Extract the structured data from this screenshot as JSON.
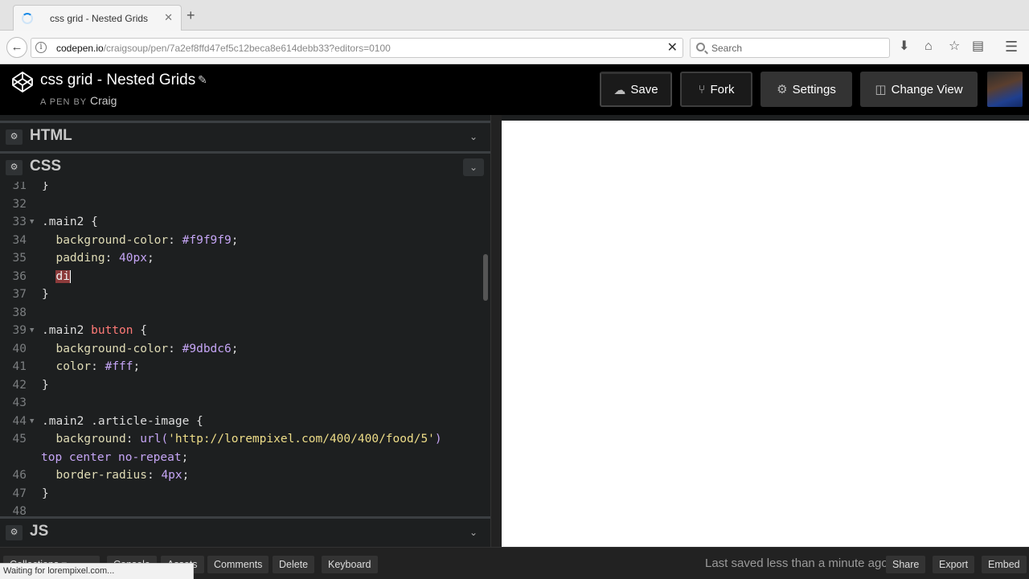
{
  "browser": {
    "tab": {
      "title": "css grid - Nested Grids",
      "close_glyph": "✕"
    },
    "new_tab_glyph": "+",
    "url": {
      "host": "codepen.io",
      "path": "/craigsoup/pen/7a2ef8ffd47ef5c12beca8e614debb33?editors=0100"
    },
    "search": {
      "placeholder": "Search"
    },
    "status_text": "Waiting for lorempixel.com..."
  },
  "header": {
    "pen_title": "css grid - Nested Grids",
    "pen_by_label": "A PEN BY",
    "author": "Craig",
    "buttons": {
      "save": "Save",
      "fork": "Fork",
      "settings": "Settings",
      "change_view": "Change View"
    }
  },
  "editors": {
    "html": {
      "name": "HTML"
    },
    "css": {
      "name": "CSS"
    },
    "js": {
      "name": "JS"
    }
  },
  "code": {
    "language": "css",
    "lines": [
      {
        "n": "31",
        "text": "}"
      },
      {
        "n": "32",
        "text": ""
      },
      {
        "n": "33",
        "text": ".main2 {"
      },
      {
        "n": "34",
        "text": "  background-color: #f9f9f9;"
      },
      {
        "n": "35",
        "text": "  padding: 40px;"
      },
      {
        "n": "36",
        "text": "  di"
      },
      {
        "n": "37",
        "text": "}"
      },
      {
        "n": "38",
        "text": ""
      },
      {
        "n": "39",
        "text": ".main2 button {"
      },
      {
        "n": "40",
        "text": "  background-color: #9dbdc6;"
      },
      {
        "n": "41",
        "text": "  color: #fff;"
      },
      {
        "n": "42",
        "text": "}"
      },
      {
        "n": "43",
        "text": ""
      },
      {
        "n": "44",
        "text": ".main2 .article-image {"
      },
      {
        "n": "45",
        "text": "  background: url('http://lorempixel.com/400/400/food/5')"
      },
      {
        "n": "",
        "text": "top center no-repeat;"
      },
      {
        "n": "46",
        "text": "  border-radius: 4px;"
      },
      {
        "n": "47",
        "text": "}"
      },
      {
        "n": "48",
        "text": ""
      }
    ]
  },
  "footer": {
    "buttons": {
      "collections": "Collections",
      "console": "Console",
      "assets": "Assets",
      "comments": "Comments",
      "delete": "Delete",
      "keyboard": "Keyboard"
    },
    "saved_status": "Last saved less than a minute ago",
    "right_buttons": {
      "share": "Share",
      "export": "Export",
      "embed": "Embed"
    }
  }
}
